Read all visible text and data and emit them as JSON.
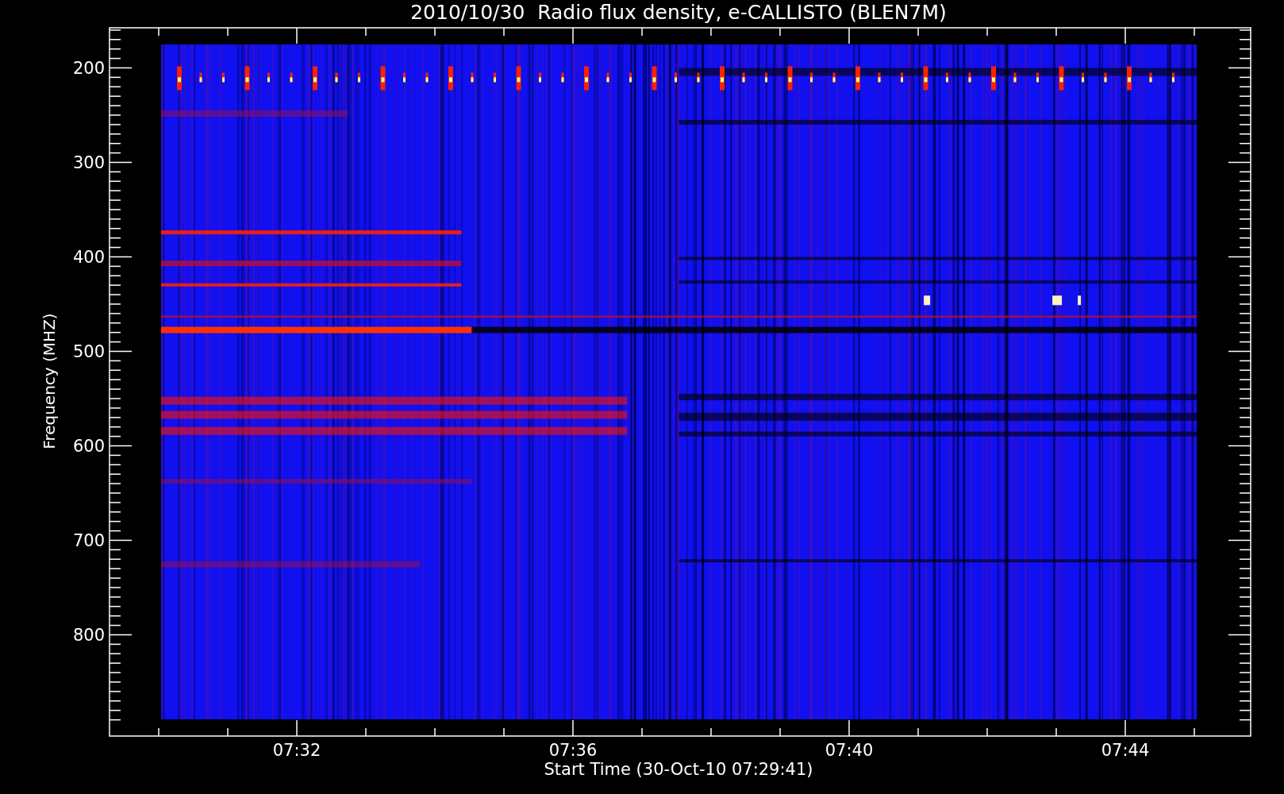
{
  "title": "2010/10/30  Radio flux density, e-CALLISTO (BLEN7M)",
  "y_axis": {
    "label": "Frequency (MHZ)",
    "ticks": [
      "200",
      "300",
      "400",
      "500",
      "600",
      "700",
      "800"
    ]
  },
  "x_axis": {
    "label": "Start Time (30-Oct-10 07:29:41)",
    "ticks": [
      "07:32",
      "07:36",
      "07:40",
      "07:44"
    ]
  }
}
